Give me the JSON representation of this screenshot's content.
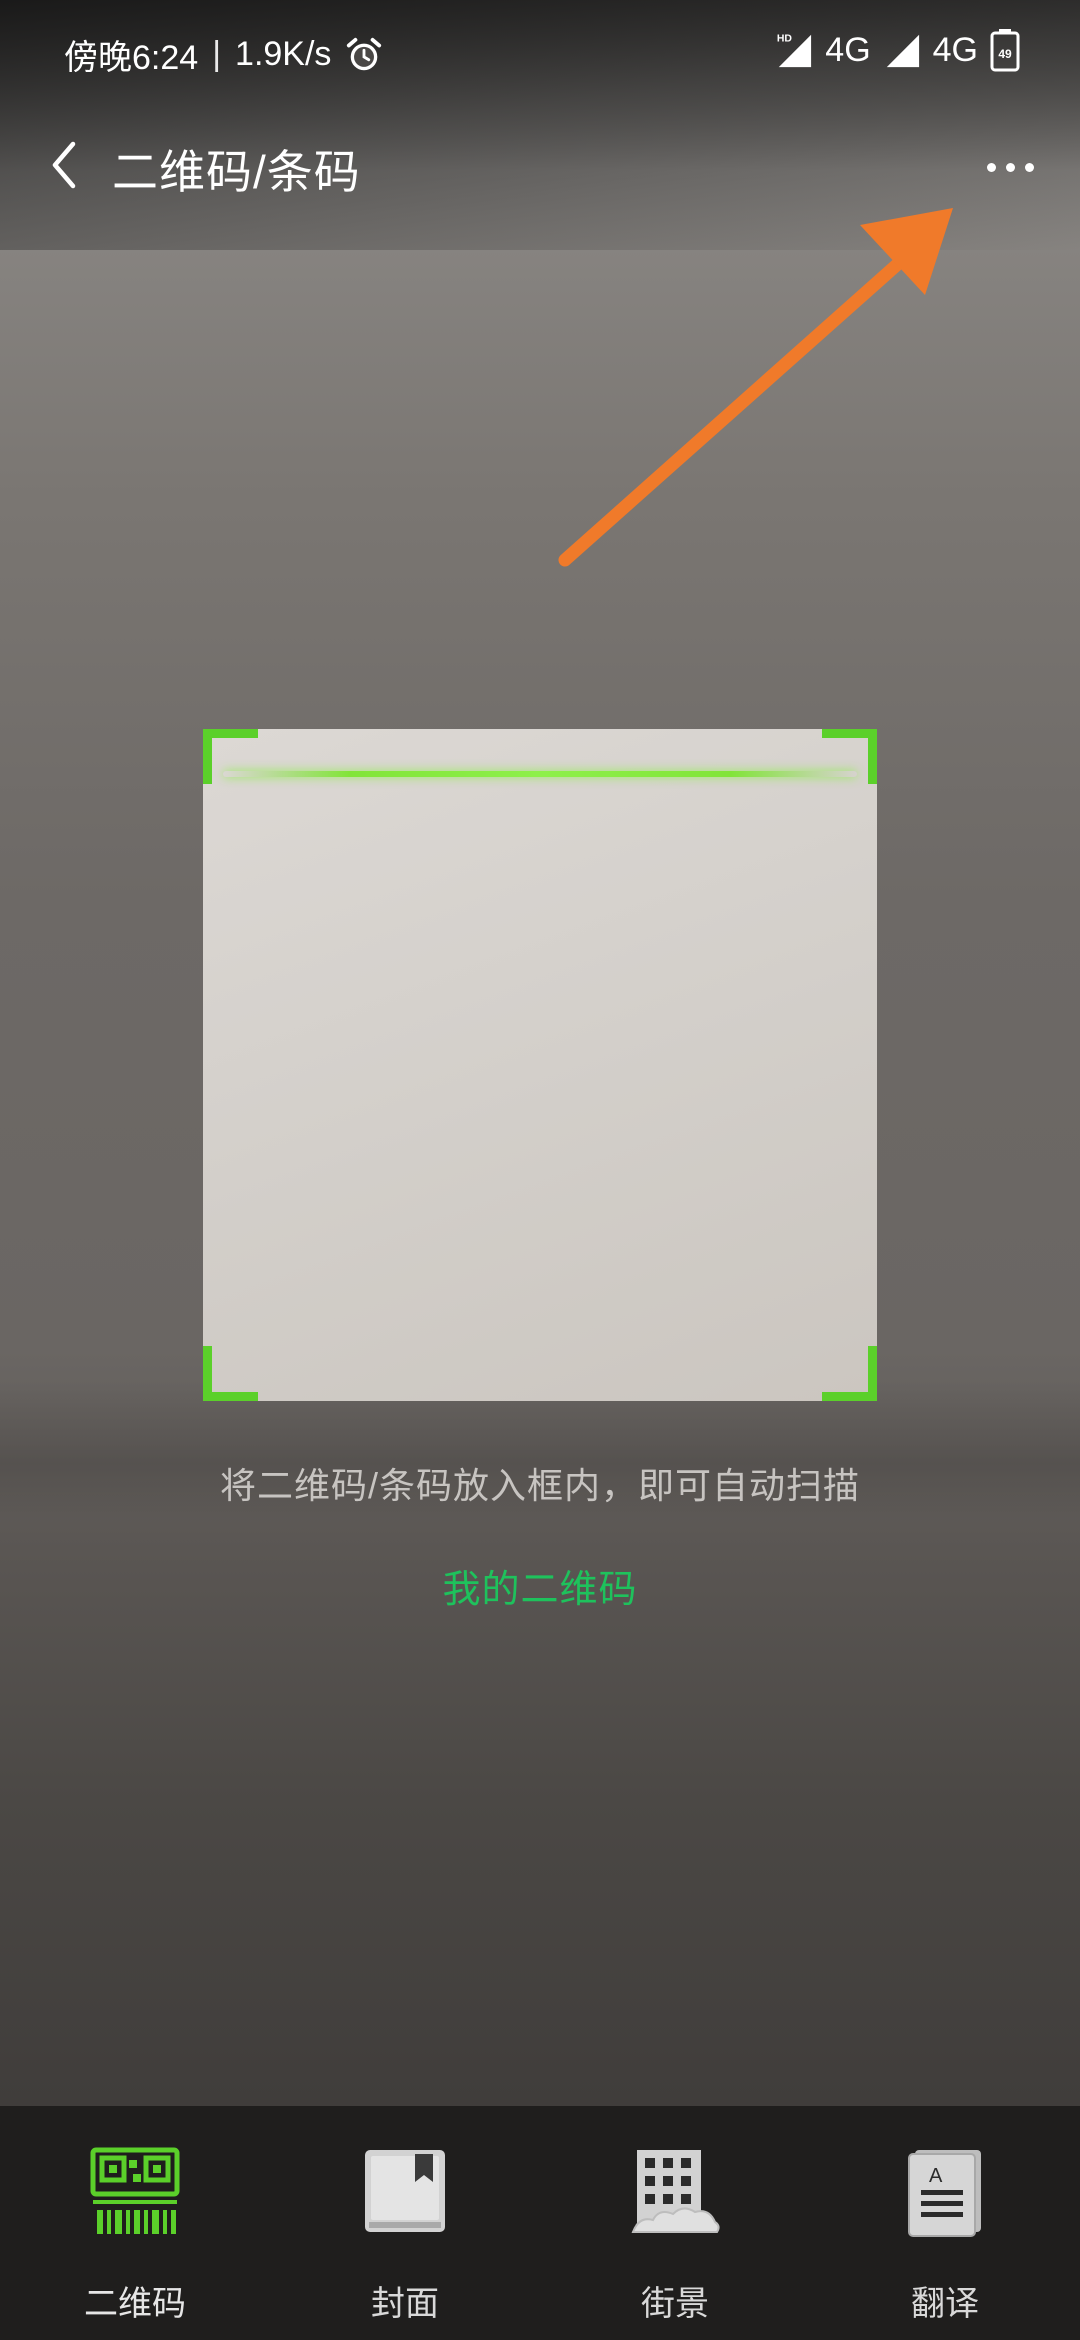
{
  "status_bar": {
    "time": "傍晚6:24",
    "separator": "|",
    "speed": "1.9K/s",
    "signal1_label": "4G",
    "signal2_label": "4G",
    "hd_label": "HD",
    "battery_level": "49",
    "icons": [
      "alarm-icon",
      "signal-icon",
      "signal-icon",
      "battery-icon"
    ]
  },
  "nav": {
    "title": "二维码/条码",
    "back_icon": "chevron-left-icon",
    "more_icon": "more-horizontal-icon"
  },
  "scanner": {
    "hint": "将二维码/条码放入框内，即可自动扫描",
    "my_qr_link": "我的二维码",
    "accent_color": "#5bd02a",
    "link_color": "#1ec25c"
  },
  "annotation": {
    "arrow_color": "#f07a2a"
  },
  "tabs": [
    {
      "label": "二维码",
      "icon": "qr-code-icon",
      "active": true
    },
    {
      "label": "封面",
      "icon": "book-cover-icon",
      "active": false
    },
    {
      "label": "街景",
      "icon": "street-view-icon",
      "active": false
    },
    {
      "label": "翻译",
      "icon": "translate-document-icon",
      "active": false
    }
  ]
}
